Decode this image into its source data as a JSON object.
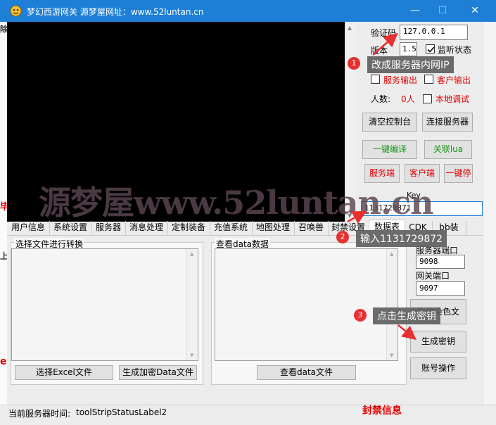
{
  "window": {
    "title": "梦幻西游网关 源梦屋网址：www.52luntan.cn"
  },
  "right_panel": {
    "captcha_label": "验证码",
    "captcha_value": "127.0.0.1",
    "version_label": "版本",
    "version_value": "1.5",
    "listen_label": "监听状态",
    "server_output_label": "服务输出",
    "client_output_label": "客户输出",
    "people_label": "人数:",
    "people_value": "0人",
    "local_debug_label": "本地调试",
    "clear_console_btn": "清空控制台",
    "connect_server_btn": "连接服务器",
    "compile_btn": "一键编译",
    "link_lua_btn": "关联lua",
    "server_btn": "服务端",
    "client_btn": "客户端",
    "stop_btn": "一键停",
    "key_label": "Key",
    "key_value": "1131729871"
  },
  "tabs": [
    "用户信息",
    "系统设置",
    "服务器",
    "消息处理",
    "定制装备",
    "充值系统",
    "地图处理",
    "召唤兽",
    "封禁设置",
    "数据表",
    "CDK",
    "bb装"
  ],
  "convert_panel": {
    "left_group_label": "选择文件进行转换",
    "right_group_label": "查看data数据",
    "select_excel_btn": "选择Excel文件",
    "gen_data_btn": "生成加密Data文件",
    "view_data_btn": "查看data文件",
    "server_port_label": "服务器端口",
    "server_port_value": "9098",
    "gateway_port_label": "网关端口",
    "gateway_port_value": "9097",
    "gen_color_btn": "生成染色文",
    "gen_key_btn": "生成密钥",
    "account_btn": "账号操作"
  },
  "status_bar": {
    "label": "当前服务器时间:",
    "value": "toolStripStatusLabel2",
    "ban_info": "封禁信息"
  },
  "watermark": "源梦屋www.52luntan.cn",
  "annotations": [
    {
      "num": "1",
      "text": "改成服务器内网IP"
    },
    {
      "num": "2",
      "text": "输入1131729872"
    },
    {
      "num": "3",
      "text": "点击生成密钥"
    }
  ],
  "background_edge": {
    "e1": "除",
    "e2": "毕",
    "e3": "上",
    "e4": "e"
  },
  "colors": {
    "titlebar": "#1e7fd6",
    "accent_red": "#e00000",
    "accent_green": "#1a9a1a",
    "callout_badge": "#e73030"
  },
  "icons": {
    "app": "game-logo-icon",
    "minimize": "minimize-icon",
    "maximize": "maximize-icon",
    "close": "close-icon"
  }
}
